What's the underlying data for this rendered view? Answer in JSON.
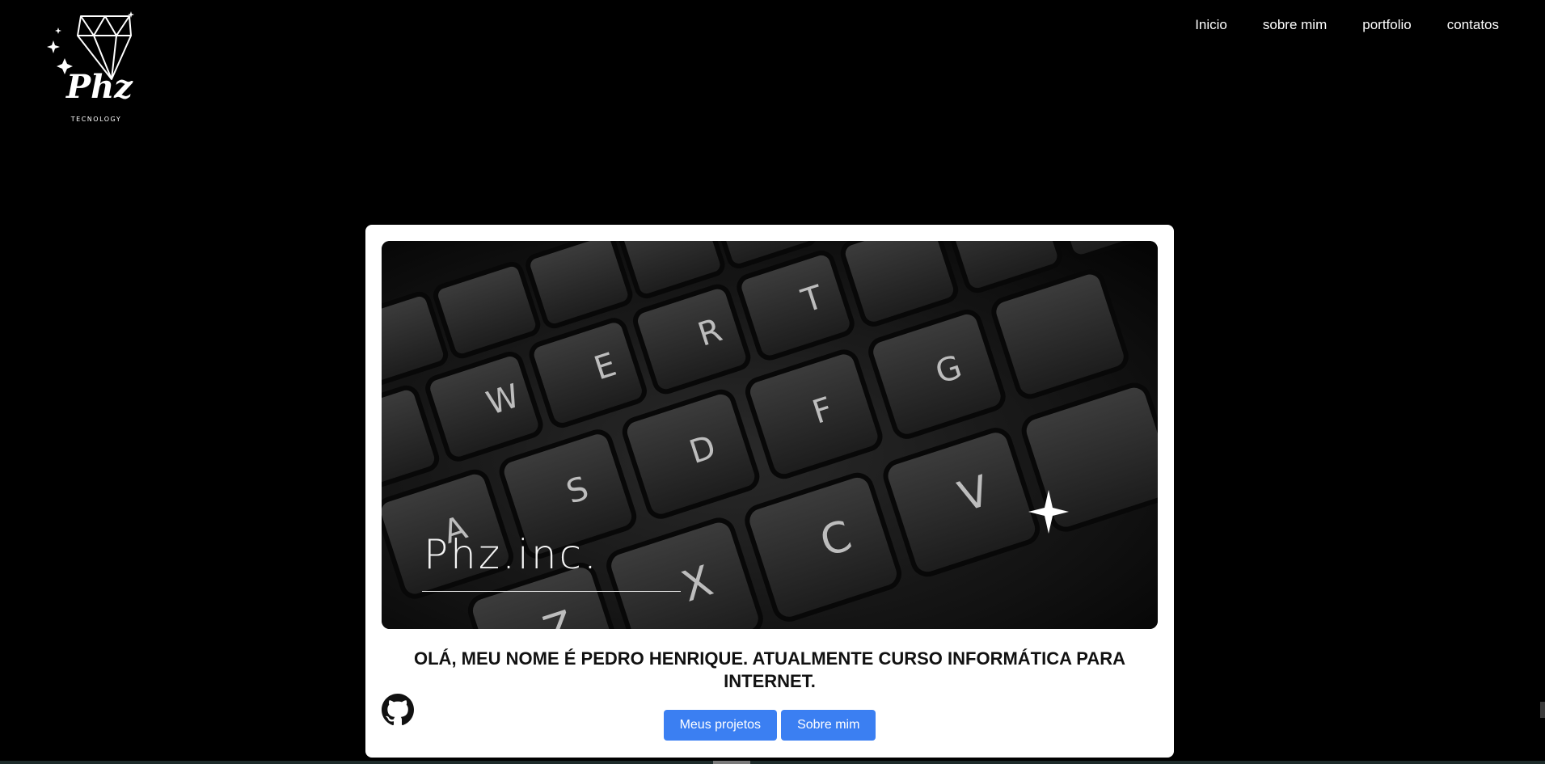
{
  "header": {
    "logo": {
      "icon": "diamond-icon",
      "script_text": "Phz",
      "subtitle": "TECNOLOGY"
    },
    "nav": [
      {
        "label": "Inicio"
      },
      {
        "label": "sobre mim"
      },
      {
        "label": "portfolio"
      },
      {
        "label": "contatos"
      }
    ]
  },
  "card": {
    "hero": {
      "title": "Phz.inc.",
      "sparkle_icon": "sparkle-icon"
    },
    "headline": "OLÁ, MEU NOME É PEDRO HENRIQUE. ATUALMENTE CURSO INFORMÁTICA PARA INTERNET.",
    "github_icon": "github-icon",
    "buttons": {
      "projects": "Meus projetos",
      "about": "Sobre mim"
    }
  },
  "colors": {
    "background": "#000000",
    "card": "#ffffff",
    "button": "#3b7ff2"
  }
}
